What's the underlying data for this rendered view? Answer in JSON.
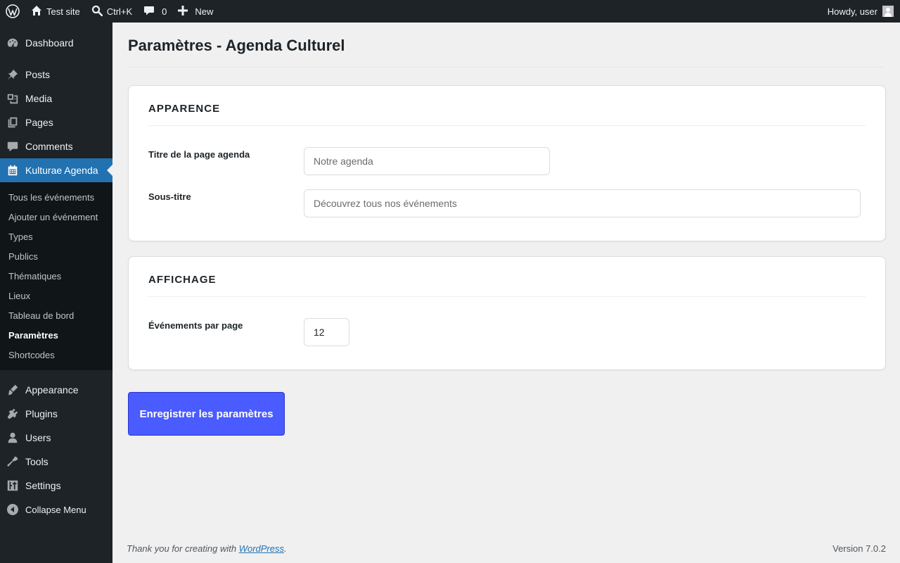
{
  "admin_bar": {
    "site_name": "Test site",
    "search_shortcut": "Ctrl+K",
    "comments_count": "0",
    "new_label": "New",
    "greeting": "Howdy, user"
  },
  "sidebar": {
    "top_items": [
      {
        "label": "Dashboard",
        "icon": "dashboard-icon"
      },
      {
        "label": "Posts",
        "icon": "pin-icon"
      },
      {
        "label": "Media",
        "icon": "media-icon"
      },
      {
        "label": "Pages",
        "icon": "pages-icon"
      },
      {
        "label": "Comments",
        "icon": "comment-icon"
      }
    ],
    "active_item": {
      "label": "Kulturae Agenda",
      "icon": "calendar-icon"
    },
    "submenu": [
      "Tous les événements",
      "Ajouter un événement",
      "Types",
      "Publics",
      "Thématiques",
      "Lieux",
      "Tableau de bord",
      "Paramètres",
      "Shortcodes"
    ],
    "current_submenu": "Paramètres",
    "bottom_items": [
      {
        "label": "Appearance",
        "icon": "brush-icon"
      },
      {
        "label": "Plugins",
        "icon": "plugin-icon"
      },
      {
        "label": "Users",
        "icon": "user-icon"
      },
      {
        "label": "Tools",
        "icon": "wrench-icon"
      },
      {
        "label": "Settings",
        "icon": "settings-icon"
      }
    ],
    "collapse_label": "Collapse Menu"
  },
  "page": {
    "title": "Paramètres - Agenda Culturel",
    "sections": {
      "appearance": {
        "heading": "APPARENCE",
        "fields": [
          {
            "label": "Titre de la page agenda",
            "value": "",
            "placeholder": "Notre agenda"
          },
          {
            "label": "Sous-titre",
            "value": "",
            "placeholder": "Découvrez tous nos événements"
          }
        ]
      },
      "display": {
        "heading": "AFFICHAGE",
        "fields": [
          {
            "label": "Événements par page",
            "value": "12",
            "placeholder": ""
          }
        ]
      }
    },
    "save_button": "Enregistrer les paramètres"
  },
  "footer": {
    "thanks_prefix": "Thank you for creating with ",
    "thanks_link": "WordPress",
    "thanks_suffix": ".",
    "version": "Version 7.0.2"
  }
}
